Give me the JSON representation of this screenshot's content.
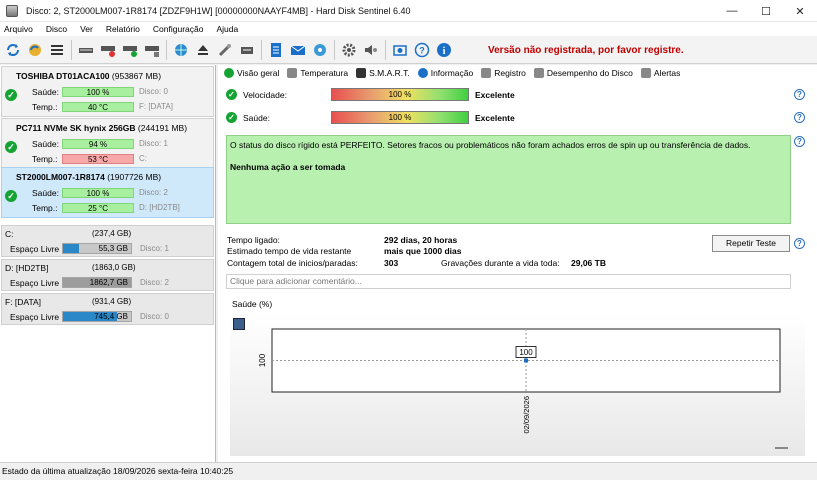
{
  "window": {
    "title": "Disco: 2, ST2000LM007-1R8174 [ZDZF9H1W] [00000000NAAYF4MB] - Hard Disk Sentinel 6.40",
    "minimize": "—",
    "maximize": "☐",
    "close": "✕"
  },
  "menu": [
    "Arquivo",
    "Disco",
    "Ver",
    "Relatório",
    "Configuração",
    "Ajuda"
  ],
  "toolbar": {
    "unregistered_notice": "Versão não registrada, por favor registre."
  },
  "disks": [
    {
      "name": "TOSHIBA DT01ACA100",
      "size": "(953867 MB)",
      "health_label": "Saúde:",
      "health": "100 %",
      "health_percent": 100,
      "health_color": "green",
      "disk_ref": "Disco: 0",
      "temp_label": "Temp.:",
      "temp": "40 °C",
      "temp_color": "green",
      "volumes": "F: [DATA]"
    },
    {
      "name": "PC711 NVMe SK hynix 256GB",
      "size": "(244191 MB)",
      "health_label": "Saúde:",
      "health": "94 %",
      "health_percent": 94,
      "health_color": "green",
      "disk_ref": "Disco: 1",
      "temp_label": "Temp.:",
      "temp": "53 °C",
      "temp_color": "red",
      "volumes": "C:"
    },
    {
      "name": "ST2000LM007-1R8174",
      "size": "(1907726 MB)",
      "health_label": "Saúde:",
      "health": "100 %",
      "health_percent": 100,
      "health_color": "green",
      "disk_ref": "Disco: 2",
      "temp_label": "Temp.:",
      "temp": "25 °C",
      "temp_color": "green",
      "volumes": "D: [HD2TB]"
    }
  ],
  "volumes": [
    {
      "name": "C:",
      "size": "(237,4 GB)",
      "free_label": "Espaço Livre",
      "free": "55,3 GB",
      "free_fraction": 0.233,
      "fill_color": "#2a88c8",
      "disk_ref": "Disco: 1"
    },
    {
      "name": "D: [HD2TB]",
      "size": "(1863,0 GB)",
      "free_label": "Espaço Livre",
      "free": "1862,7 GB",
      "free_fraction": 1.0,
      "fill_color": "#9c9c9c",
      "disk_ref": "Disco: 2"
    },
    {
      "name": "F: [DATA]",
      "size": "(931,4 GB)",
      "free_label": "Espaço Livre",
      "free": "745,4 GB",
      "free_fraction": 0.8,
      "fill_color": "#2a88c8",
      "disk_ref": "Disco: 0"
    }
  ],
  "tabs": [
    "Visão geral",
    "Temperatura",
    "S.M.A.R.T.",
    "Informação",
    "Registro",
    "Desempenho do Disco",
    "Alertas"
  ],
  "overview": {
    "speed_label": "Velocidade:",
    "speed_value": "100 %",
    "speed_rating": "Excelente",
    "health_label": "Saúde:",
    "health_value": "100 %",
    "health_rating": "Excelente",
    "status_text": "O status do disco rígido está PERFEITO. Setores fracos ou problemáticos não foram achados erros de spin up ou transferência de dados.",
    "status_action": "Nenhuma ação a ser tomada",
    "power_on_label": "Tempo ligado:",
    "power_on_value": "292 dias, 20 horas",
    "lifetime_label": "Estimado tempo de vida restante",
    "lifetime_value": "mais que 1000 dias",
    "starts_label": "Contagem total de inicios/paradas:",
    "starts_value": "303",
    "writes_label": "Gravações durante a vida toda:",
    "writes_value": "29,06 TB",
    "repeat_button": "Repetir Teste",
    "comment_placeholder": "Clique para adicionar  comentário..."
  },
  "chart_data": {
    "type": "line",
    "title": "Saúde (%)",
    "x": [
      "02/09/2026"
    ],
    "series": [
      {
        "values": [
          100
        ]
      }
    ],
    "y_tick_labels": [
      "100"
    ],
    "data_labels": [
      "100"
    ],
    "grid": true
  },
  "statusbar": "Estado da última atualização 18/09/2026 sexta-feira 10:40:25"
}
